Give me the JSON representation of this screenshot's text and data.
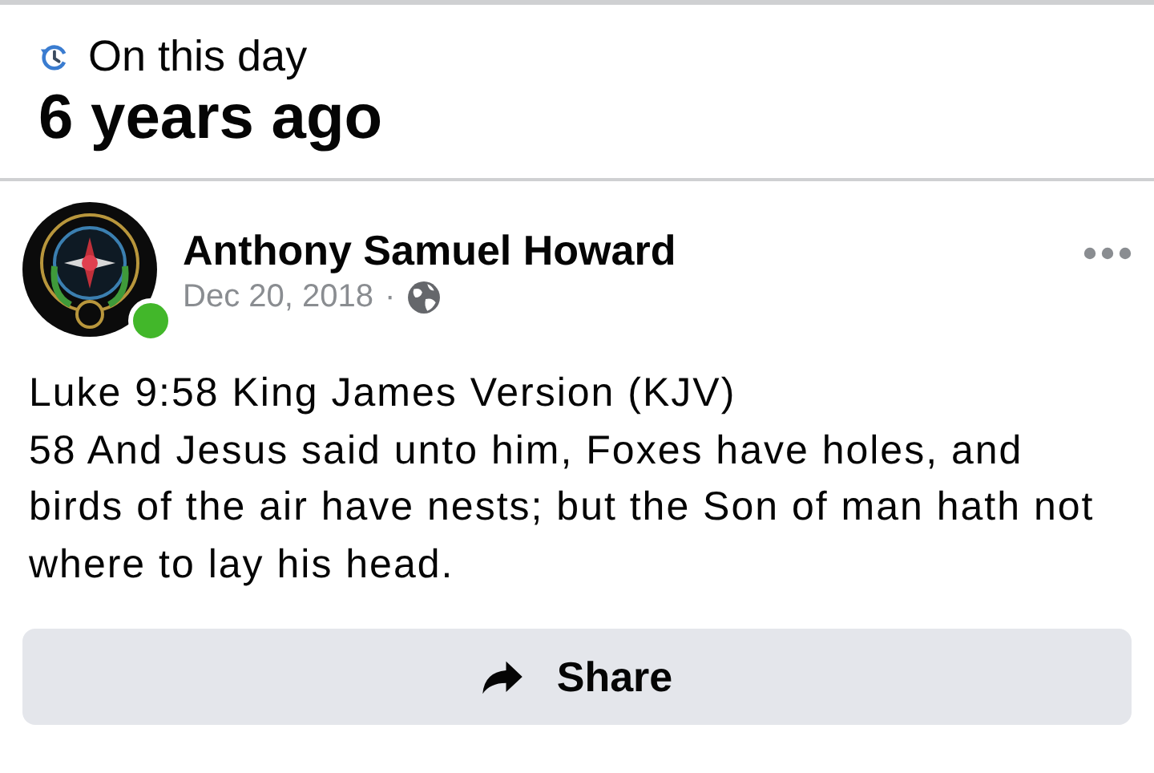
{
  "memory": {
    "label": "On this day",
    "title": "6 years ago"
  },
  "post": {
    "author": {
      "name": "Anthony Samuel Howard",
      "online": true
    },
    "date": "Dec 20, 2018",
    "separator": "·",
    "body": [
      "Luke 9:58 King James Version (KJV)",
      "58 And Jesus said unto him, Foxes have holes, and birds of the air have nests; but the Son of man hath not where to lay his head."
    ]
  },
  "actions": [
    {
      "label": "Share",
      "kind": "share"
    }
  ]
}
